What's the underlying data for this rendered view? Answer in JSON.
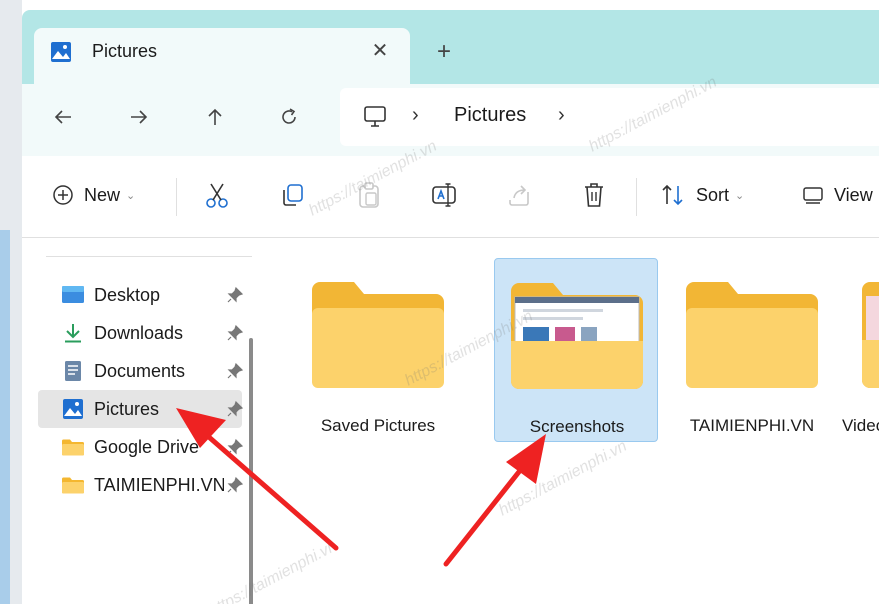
{
  "tab": {
    "title": "Pictures",
    "close_glyph": "✕",
    "new_tab_glyph": "+"
  },
  "navigation": {
    "back_glyph": "←",
    "forward_glyph": "→",
    "up_glyph": "↑",
    "refresh_glyph": "↻"
  },
  "address": {
    "separator": "›",
    "crumbs": [
      "Pictures"
    ]
  },
  "toolbar": {
    "new_label": "New",
    "new_chevron": "⌄",
    "sort_label": "Sort",
    "sort_chevron": "⌄",
    "view_label": "View",
    "icons": [
      "cut-icon",
      "copy-icon",
      "paste-icon",
      "rename-icon",
      "share-icon",
      "delete-icon"
    ]
  },
  "sidebar": {
    "items": [
      {
        "label": "Desktop",
        "icon": "desktop-icon",
        "pinned": true
      },
      {
        "label": "Downloads",
        "icon": "download-icon",
        "pinned": true
      },
      {
        "label": "Documents",
        "icon": "documents-icon",
        "pinned": true
      },
      {
        "label": "Pictures",
        "icon": "pictures-icon",
        "pinned": true,
        "selected": true
      },
      {
        "label": "Google Drive",
        "icon": "folder-icon",
        "pinned": true
      },
      {
        "label": "TAIMIENPHI.VN",
        "icon": "folder-icon",
        "pinned": true
      }
    ]
  },
  "folders": [
    {
      "label": "Saved Pictures",
      "selected": false
    },
    {
      "label": "Screenshots",
      "selected": true
    },
    {
      "label": "TAIMIENPHI.VN",
      "selected": false
    },
    {
      "label": "Videos",
      "selected": false
    }
  ],
  "watermark": "https://taimienphi.vn",
  "colors": {
    "titlebar": "#b3e6e6",
    "addressbar": "#f2fafa",
    "folder_yellow": "#fcd26b",
    "folder_dark": "#f2b635",
    "selection": "#cce4f7",
    "arrow_red": "#ee2222"
  }
}
